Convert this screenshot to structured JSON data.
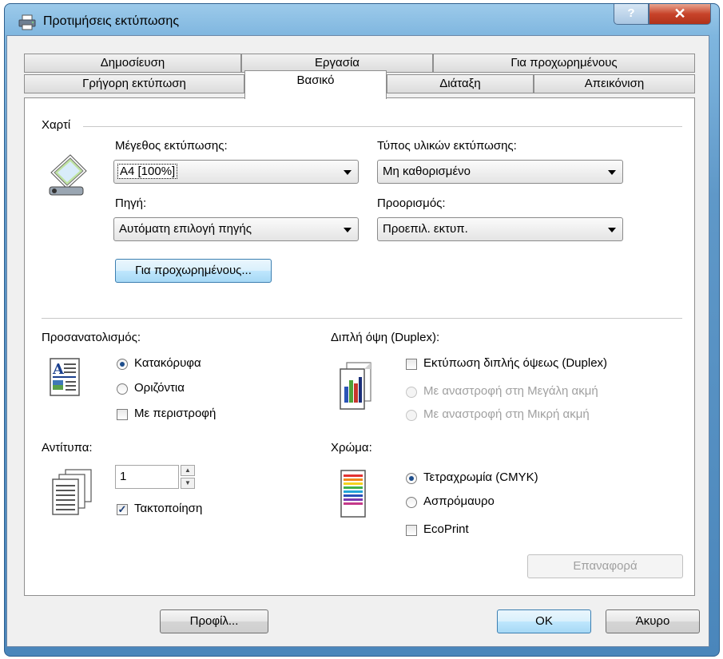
{
  "window": {
    "title": "Προτιμήσεις εκτύπωσης",
    "help_label": "?",
    "close_label": "✕"
  },
  "tabs_row1": [
    {
      "label": "Δημοσίευση"
    },
    {
      "label": "Εργασία"
    },
    {
      "label": "Για προχωρημένους"
    }
  ],
  "tabs_row2": [
    {
      "label": "Γρήγορη εκτύπωση"
    },
    {
      "label": "Βασικό",
      "active": true
    },
    {
      "label": "Διάταξη"
    },
    {
      "label": "Απεικόνιση"
    }
  ],
  "paper": {
    "group_label": "Χαρτί",
    "print_size_label": "Μέγεθος εκτύπωσης:",
    "print_size_value": "A4 [100%]",
    "media_type_label": "Τύπος υλικών εκτύπωσης:",
    "media_type_value": "Μη καθορισμένο",
    "source_label": "Πηγή:",
    "source_value": "Αυτόματη επιλογή πηγής",
    "destination_label": "Προορισμός:",
    "destination_value": "Προεπιλ. εκτυπ.",
    "advanced_button": "Για προχωρημένους..."
  },
  "orientation": {
    "label": "Προσανατολισμός:",
    "portrait": "Κατακόρυφα",
    "landscape": "Οριζόντια",
    "rotated": "Με περιστροφή",
    "selected": "portrait",
    "rotated_checked": false
  },
  "duplex": {
    "label": "Διπλή όψη (Duplex):",
    "checkbox": "Εκτύπωση διπλής όψεως (Duplex)",
    "checked": false,
    "long_edge": "Με αναστροφή στη Μεγάλη ακμή",
    "short_edge": "Με αναστροφή στη Μικρή ακμή"
  },
  "copies": {
    "label": "Αντίτυπα:",
    "value": "1",
    "collate": "Τακτοποίηση",
    "collate_checked": true
  },
  "color": {
    "label": "Χρώμα:",
    "cmyk": "Τετραχρωμία (CMYK)",
    "bw": "Ασπρόμαυρο",
    "ecoprint": "EcoPrint",
    "selected": "cmyk",
    "ecoprint_checked": false
  },
  "reset_button": "Επαναφορά",
  "footer": {
    "profile_button": "Προφίλ...",
    "ok_button": "OK",
    "cancel_button": "Άκυρο"
  }
}
